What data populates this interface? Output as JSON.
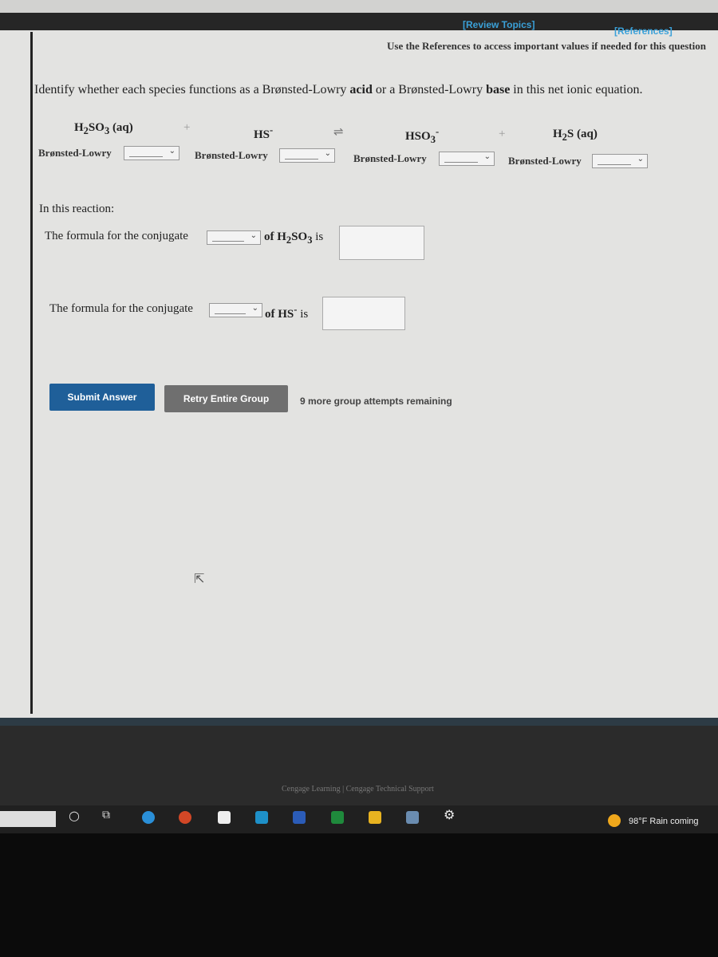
{
  "header": {
    "review_topics": "[Review Topics]",
    "references": "[References]",
    "note": "Use the References to access important values if needed for this question"
  },
  "question": {
    "prefix": "Identify whether each species functions as a Brønsted-Lowry ",
    "acid": "acid",
    "middle": " or a Brønsted-Lowry ",
    "base": "base",
    "suffix": " in this net ionic equation."
  },
  "equation": {
    "species": [
      {
        "base": "H",
        "sub1": "2",
        "mid": "SO",
        "sub2": "3",
        "tail": " (aq)"
      },
      {
        "base": "HS",
        "sup": "-"
      },
      {
        "base": "HSO",
        "sub2": "3",
        "sup": "-"
      },
      {
        "base": "H",
        "sub1": "2",
        "mid": "S",
        "tail": " (aq)"
      }
    ],
    "plus": "+",
    "arrow": "⇌",
    "select_label": "Brønsted-Lowry",
    "select_value": ""
  },
  "reaction": {
    "heading": "In this reaction:",
    "q1_prefix": "The formula for the conjugate",
    "q1_suffix_of": "of H",
    "q1_sub1": "2",
    "q1_mid": "SO",
    "q1_sub2": "3",
    "q1_is": " is",
    "q2_prefix": "The formula for the conjugate",
    "q2_of": "of HS",
    "q2_sup": "-",
    "q2_is": " is"
  },
  "actions": {
    "submit": "Submit Answer",
    "retry": "Retry Entire Group",
    "attempts": "9 more group attempts remaining"
  },
  "footer": {
    "text": "Cengage Learning  |  Cengage Technical Support"
  },
  "taskbar": {
    "icons": [
      "cortana-icon",
      "task-view-icon",
      "edge-icon",
      "powerpoint-icon",
      "store-icon",
      "mail-icon",
      "word-icon",
      "excel-icon",
      "file-explorer-icon",
      "calculator-icon",
      "settings-icon"
    ],
    "weather": "98°F  Rain coming"
  },
  "colors": {
    "link": "#3aa0d8",
    "submit": "#1f5f99",
    "retry": "#6f6f6f"
  }
}
